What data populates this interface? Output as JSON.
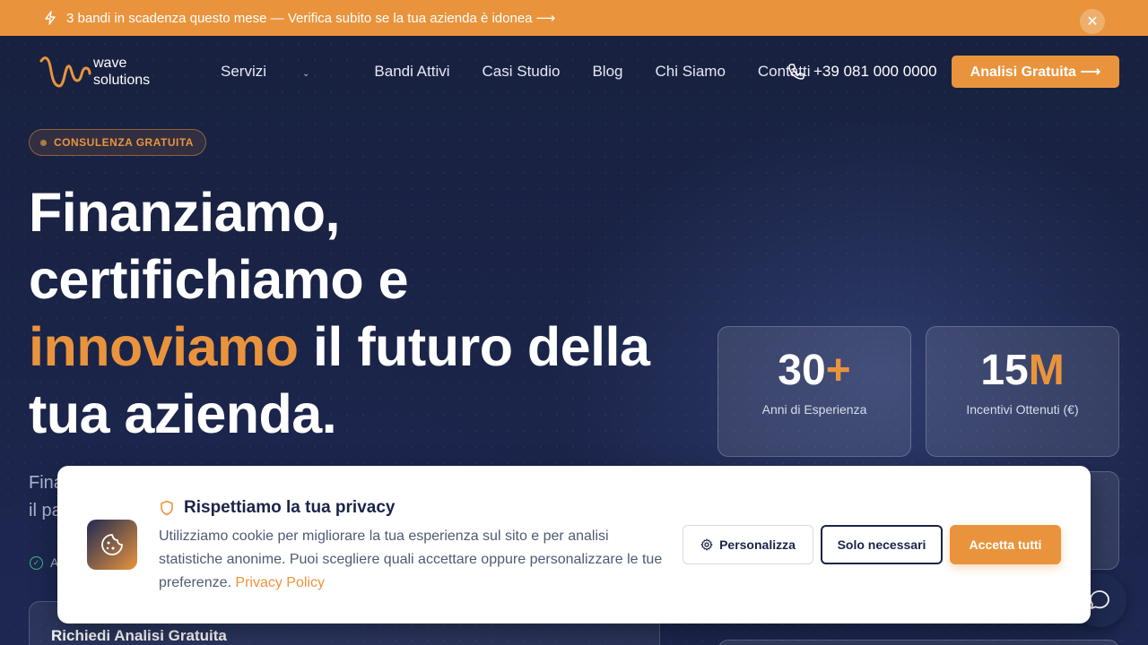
{
  "announcement": {
    "text": "3 bandi in scadenza questo mese — Verifica subito se la tua azienda è idonea ⟶",
    "close_label": "✕"
  },
  "logo": {
    "line1": "wave",
    "line2": "solutions"
  },
  "nav": {
    "items": [
      "Servizi",
      "Bandi Attivi",
      "Casi Studio",
      "Blog",
      "Chi Siamo",
      "Contatti"
    ],
    "phone": "+39 081 000 0000",
    "cta": "Analisi Gratuita ⟶"
  },
  "hero": {
    "badge": "CONSULENZA GRATUITA",
    "headline_line1": "Finanziamo,",
    "headline_line2": "certifichiamo e",
    "headline_accent": "innoviamo",
    "headline_line3_rest": " il futuro della",
    "headline_line4": "tua azienda.",
    "sub_line1": "Fina",
    "sub_line2": "il pa",
    "check_text": "A",
    "form_title": "Richiedi Analisi Gratuita"
  },
  "stats": [
    {
      "number": "30",
      "suffix": "+",
      "label": "Anni di Esperienza"
    },
    {
      "number": "15",
      "suffix": "M",
      "label": "Incentivi Ottenuti (€)"
    }
  ],
  "cookie": {
    "title": "Rispettiamo la tua privacy",
    "text": "Utilizziamo cookie per migliorare la tua esperienza sul sito e per analisi statistiche anonime. Puoi scegliere quali accettare oppure personalizzare le tue preferenze. ",
    "link": "Privacy Policy",
    "btn_customize": "Personalizza",
    "btn_necessary": "Solo necessari",
    "btn_accept": "Accetta tutti"
  },
  "colors": {
    "accent": "#e9943d",
    "navy": "#1b2447"
  },
  "icons": [
    "bolt-icon",
    "close-icon",
    "phone-icon",
    "chevron-down-icon",
    "check-circle-icon",
    "shield-icon",
    "cookie-icon",
    "gear-icon",
    "chat-icon"
  ]
}
